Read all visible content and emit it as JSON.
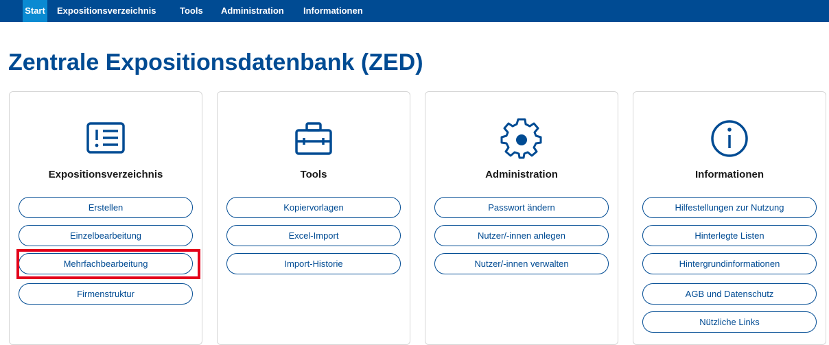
{
  "nav": {
    "start": "Start",
    "expositionsverzeichnis": "Expositionsverzeichnis",
    "tools": "Tools",
    "administration": "Administration",
    "informationen": "Informationen"
  },
  "page": {
    "title": "Zentrale Expositionsdatenbank (ZED)"
  },
  "cards": [
    {
      "title": "Expositionsverzeichnis",
      "icon": "list-icon",
      "buttons": [
        "Erstellen",
        "Einzelbearbeitung",
        "Mehrfachbearbeitung",
        "Firmenstruktur"
      ]
    },
    {
      "title": "Tools",
      "icon": "toolbox-icon",
      "buttons": [
        "Kopiervorlagen",
        "Excel-Import",
        "Import-Historie"
      ]
    },
    {
      "title": "Administration",
      "icon": "gear-icon",
      "buttons": [
        "Passwort ändern",
        "Nutzer/-innen anlegen",
        "Nutzer/-innen verwalten"
      ]
    },
    {
      "title": "Informationen",
      "icon": "info-icon",
      "buttons": [
        "Hilfestellungen zur Nutzung",
        "Hinterlegte Listen",
        "Hintergrundinformationen",
        "AGB und Datenschutz",
        "Nützliche Links"
      ]
    }
  ],
  "colors": {
    "brand": "#004b93",
    "active_tab": "#0a8ad2",
    "highlight": "#e3001b"
  }
}
